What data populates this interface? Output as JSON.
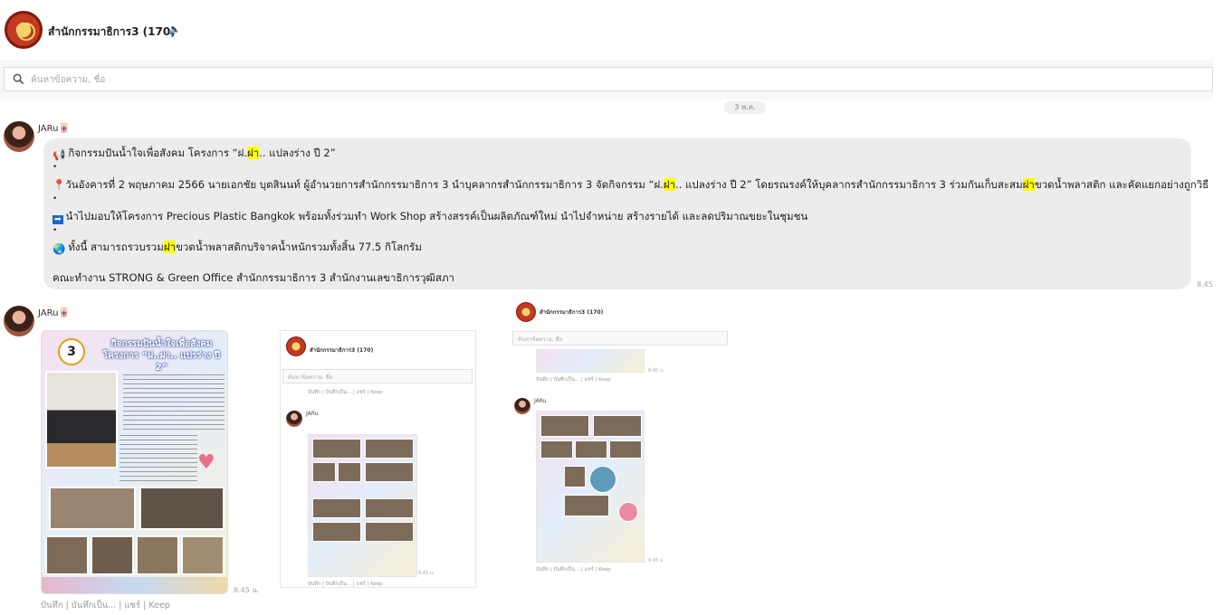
{
  "header": {
    "title": "สำนักกรรมาธิการ3",
    "member_count": "(170)",
    "mute_icon": "speaker-muted-icon"
  },
  "search": {
    "placeholder": "ค้นหาข้อความ, ชื่อ",
    "value": ""
  },
  "date_separator": "3 พ.ค.",
  "messages": [
    {
      "sender": "JARu",
      "sender_emoji": "🀄",
      "lines": [
        {
          "icon": "megaphone-icon",
          "emoji": "📢",
          "parts": [
            "กิจกรรมปันน้ำใจเพื่อสังคม โครงการ “ฝ.",
            "ฝา",
            ".. แปลงร่าง ปี 2”"
          ]
        },
        {
          "icon": "pin-icon",
          "emoji": "📍",
          "parts": [
            "วันอังคารที่ 2 พฤษภาคม 2566 นายเอกชัย บุตสินนท์ ผู้อำนวยการสำนักกรรมาธิการ 3  นำบุคลากรสำนักกรรมาธิการ 3 จัดกิจกรรม “ฝ.",
            "ฝา",
            ".. แปลงร่าง ปี 2” โดยรณรงค์ให้บุคลากรสำนักกรรมาธิการ 3 ร่วมกันเก็บสะสม",
            "ฝา",
            "ขวดน้ำพลาสติก และคัดแยกอย่างถูกวิธี"
          ]
        },
        {
          "icon": "arrow-right-icon",
          "emoji": "➡",
          "parts": [
            "นำไปมอบให้โครงการ Precious Plastic Bangkok พร้อมทั้งร่วมทำ Work Shop สร้างสรรค์เป็นผลิตภัณฑ์ใหม่ นำไปจำหน่าย สร้างรายได้ และลดปริมาณขยะในชุมชน"
          ]
        },
        {
          "icon": "globe-icon",
          "emoji": "🌏",
          "parts": [
            "ทั้งนี้ สามารถรวบรวม",
            "ฝา",
            "ขวดน้ำพลาสติกบริจาคน้ำหนักรวมทั้งสิ้น 77.5 กิโลกรัม"
          ]
        },
        {
          "icon": "",
          "emoji": "",
          "parts": [
            "คณะทำงาน STRONG & Green Office สำนักกรรมาธิการ 3 สำนักงานเลขาธิการวุฒิสภา"
          ]
        }
      ],
      "bullet": "•",
      "time": "8.45"
    },
    {
      "sender": "JARu",
      "sender_emoji": "🀄",
      "time": "8.45 น.",
      "poster": {
        "badge": "3",
        "title_line1": "กิจกรรมปันน้ำใจเพื่อสังคม",
        "title_line2": "โครงการ “ฝ..ฝา.. แปรร่าง ปี 2”"
      },
      "actions": [
        "บันทึก",
        "บันทึกเป็น...",
        "แชร์",
        "Keep"
      ]
    }
  ],
  "thumb_a": {
    "title": "สำนักกรรมาธิการ3 (170)",
    "search": "ค้นหาข้อความ, ชื่อ",
    "actions": "บันทึก | บันทึกเป็น... | แชร์ | Keep",
    "sender": "JARu",
    "time": "8.45 น."
  },
  "thumb_b": {
    "title": "สำนักกรรมาธิการ3 (170)",
    "search": "ค้นหาข้อความ, ชื่อ",
    "time_top": "8.45 น.",
    "actions": "บันทึก | บันทึกเป็น... | แชร์ | Keep",
    "sender": "JARu",
    "time": "8.45 น."
  }
}
